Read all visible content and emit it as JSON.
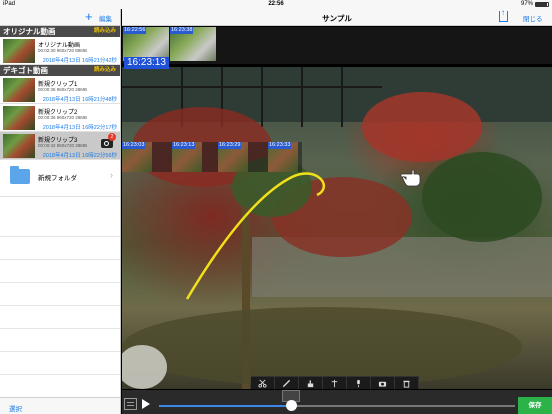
{
  "status_bar": {
    "carrier": "iPad",
    "time": "22:56",
    "battery": "97%"
  },
  "sidebar": {
    "edit_label": "編集",
    "sections": [
      {
        "title": "オリジナル動画",
        "read_label": "読み込み",
        "items": [
          {
            "name": "オリジナル動画",
            "meta": "00:02:30 960x720 89MB",
            "date": "2018年4月13日 16時21分42秒"
          }
        ]
      },
      {
        "title": "デキゴト動画",
        "read_label": "読み込み",
        "items": [
          {
            "name": "新規クリップ1",
            "meta": "00:00:36 960x720 28MB",
            "date": "2018年4月13日 16時21分48秒"
          },
          {
            "name": "新規クリップ2",
            "meta": "00:00:36 960x720 28MB",
            "date": "2018年4月13日 16時22分17秒"
          },
          {
            "name": "新規クリップ3",
            "meta": "00:00:42 960x720 28MB",
            "date": "2018年4月13日 16時22分56秒",
            "badge": "2"
          }
        ]
      }
    ],
    "folder": {
      "name": "新規フォルダ"
    },
    "select_label": "選択"
  },
  "main": {
    "title": "サンプル",
    "close_label": "閉じる",
    "save_label": "保存",
    "top_thumbs": [
      {
        "stamp": "16:22:56"
      },
      {
        "stamp": "16:23:38"
      }
    ],
    "current_time": "16:23:13",
    "mid_thumbs": [
      {
        "stamp": "16:23:03"
      },
      {
        "stamp": "16:23:13"
      },
      {
        "stamp": "16:23:29"
      },
      {
        "stamp": "16:23:33"
      }
    ],
    "tools": [
      "scissors-icon",
      "pencil-icon",
      "hand-pointer-icon",
      "pin-icon",
      "microphone-icon",
      "camera-icon",
      "trash-icon"
    ],
    "playback": {
      "progress": 0.37,
      "marker": 0.37
    }
  },
  "colors": {
    "accent": "#1a7be8",
    "save": "#2bb34a",
    "stamp": "#2a5bd0",
    "section_header": "#4a4a4a",
    "annotation": "#f2e01a"
  }
}
